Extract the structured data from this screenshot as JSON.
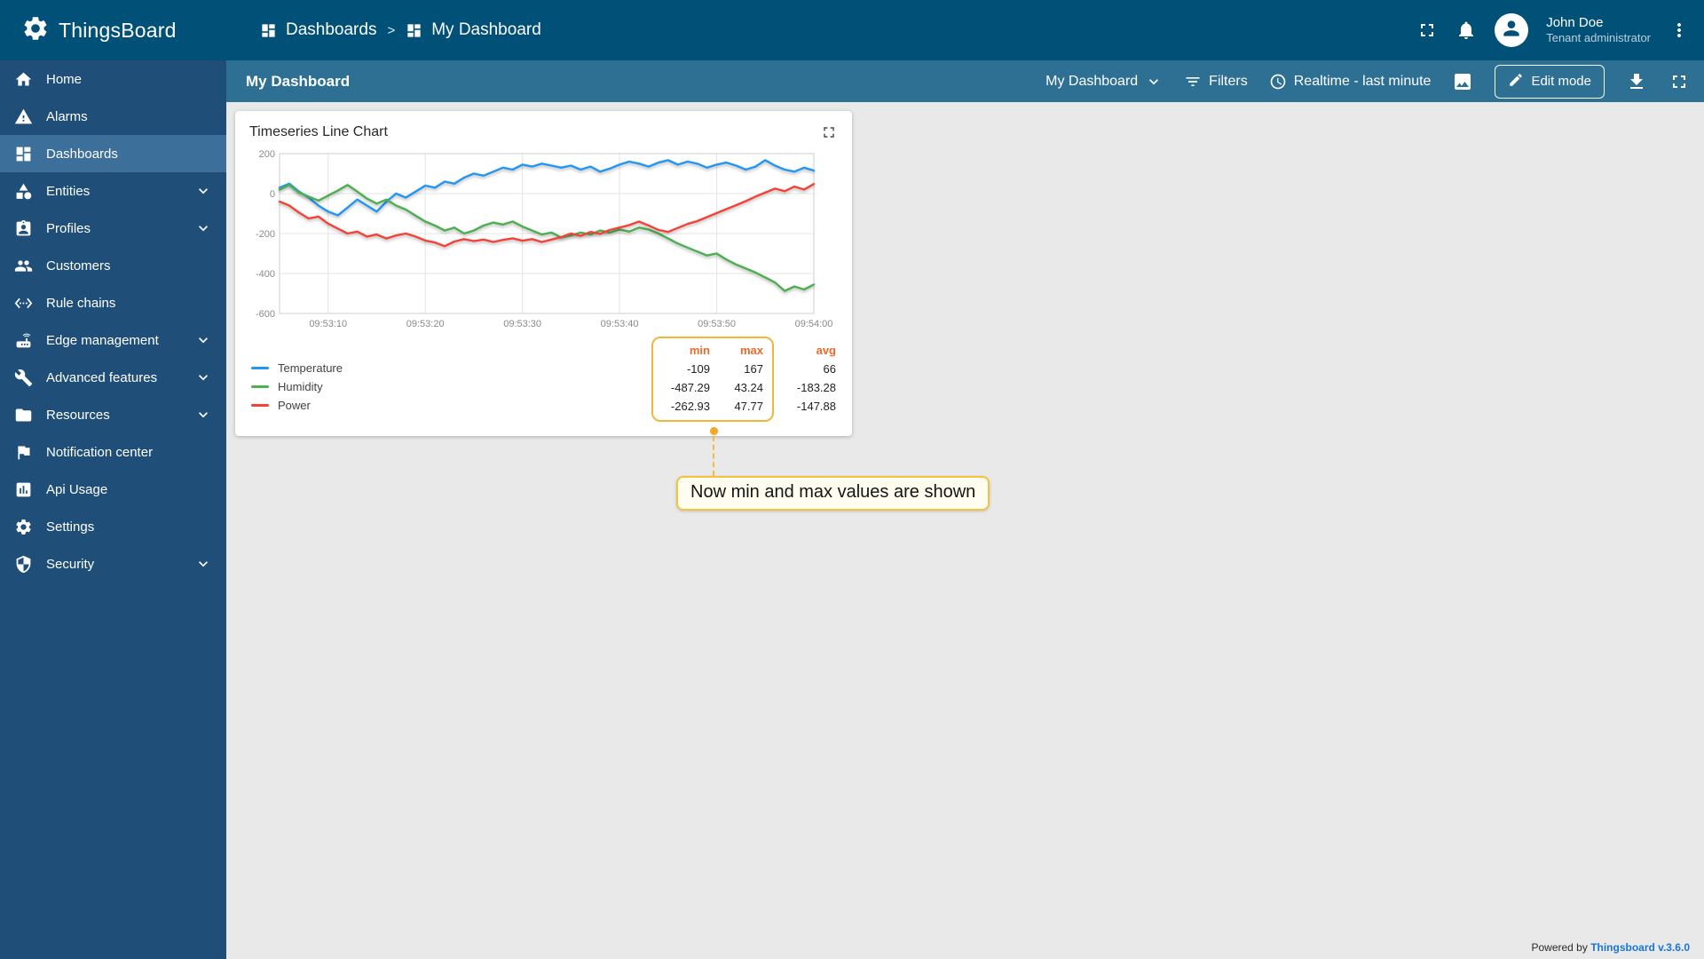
{
  "app": {
    "logo_text": "ThingsBoard",
    "powered_by": "Powered by",
    "powered_link": "Thingsboard v.3.6.0"
  },
  "topbar": {
    "separator": ">",
    "breadcrumb": [
      {
        "label": "Dashboards",
        "icon": "dashboards"
      },
      {
        "label": "My Dashboard",
        "icon": "dashboards"
      }
    ],
    "user": {
      "name": "John Doe",
      "role": "Tenant administrator"
    }
  },
  "sidebar": {
    "items": [
      {
        "label": "Home",
        "icon": "home",
        "expandable": false,
        "active": false
      },
      {
        "label": "Alarms",
        "icon": "alarms",
        "expandable": false,
        "active": false
      },
      {
        "label": "Dashboards",
        "icon": "dashboards",
        "expandable": false,
        "active": true
      },
      {
        "label": "Entities",
        "icon": "entities",
        "expandable": true,
        "active": false
      },
      {
        "label": "Profiles",
        "icon": "profiles",
        "expandable": true,
        "active": false
      },
      {
        "label": "Customers",
        "icon": "customers",
        "expandable": false,
        "active": false
      },
      {
        "label": "Rule chains",
        "icon": "rule-chains",
        "expandable": false,
        "active": false
      },
      {
        "label": "Edge management",
        "icon": "edge",
        "expandable": true,
        "active": false
      },
      {
        "label": "Advanced features",
        "icon": "advanced",
        "expandable": true,
        "active": false
      },
      {
        "label": "Resources",
        "icon": "resources",
        "expandable": true,
        "active": false
      },
      {
        "label": "Notification center",
        "icon": "notification",
        "expandable": false,
        "active": false
      },
      {
        "label": "Api Usage",
        "icon": "api-usage",
        "expandable": false,
        "active": false
      },
      {
        "label": "Settings",
        "icon": "settings",
        "expandable": false,
        "active": false
      },
      {
        "label": "Security",
        "icon": "security",
        "expandable": true,
        "active": false
      }
    ]
  },
  "toolbar": {
    "title": "My Dashboard",
    "dashboard_select": "My Dashboard",
    "filters_label": "Filters",
    "time_label": "Realtime - last minute",
    "edit_label": "Edit mode"
  },
  "widget": {
    "title": "Timeseries Line Chart",
    "legend": {
      "headers": [
        "min",
        "max",
        "avg"
      ],
      "rows": [
        {
          "label": "Temperature",
          "color": "#2196f3",
          "min": "-109",
          "max": "167",
          "avg": "66"
        },
        {
          "label": "Humidity",
          "color": "#4caf50",
          "min": "-487.29",
          "max": "43.24",
          "avg": "-183.28"
        },
        {
          "label": "Power",
          "color": "#f44336",
          "min": "-262.93",
          "max": "47.77",
          "avg": "-147.88"
        }
      ]
    }
  },
  "annotation": {
    "text": "Now min and max values are shown"
  },
  "colors": {
    "highlight_box": "#f2b63c",
    "legend_header": "#f3672a",
    "link": "#1976d2",
    "topbar": "#015078",
    "sidebar": "#1f4f78",
    "toolbar": "#2e7093"
  },
  "chart_data": {
    "type": "line",
    "title": "Timeseries Line Chart",
    "xlabel": "",
    "ylabel": "",
    "grid": true,
    "legend_position": "bottom",
    "xlim": [
      0,
      55
    ],
    "ylim": [
      -600,
      200
    ],
    "y_ticks": [
      200,
      0,
      -200,
      -400,
      -600
    ],
    "x_ticks": [
      "09:53:10",
      "09:53:20",
      "09:53:30",
      "09:53:40",
      "09:53:50",
      "09:54:00"
    ],
    "tick_x": [
      5,
      15,
      25,
      35,
      45,
      55
    ],
    "series": [
      {
        "name": "Temperature",
        "color": "#2196f3",
        "min": -109,
        "max": 167,
        "avg": 66,
        "values": [
          30,
          50,
          10,
          -20,
          -60,
          -90,
          -109,
          -70,
          -30,
          -60,
          -90,
          -40,
          0,
          -20,
          10,
          40,
          30,
          60,
          50,
          80,
          100,
          90,
          110,
          130,
          120,
          145,
          135,
          150,
          140,
          130,
          140,
          120,
          135,
          110,
          125,
          145,
          160,
          150,
          135,
          155,
          167,
          145,
          160,
          150,
          130,
          145,
          155,
          140,
          120,
          135,
          167,
          140,
          120,
          110,
          130,
          115
        ]
      },
      {
        "name": "Humidity",
        "color": "#4caf50",
        "min": -487.29,
        "max": 43.24,
        "avg": -183.28,
        "values": [
          20,
          43,
          5,
          -15,
          -35,
          -10,
          15,
          43,
          10,
          -25,
          -50,
          -30,
          -60,
          -80,
          -110,
          -140,
          -160,
          -185,
          -170,
          -200,
          -185,
          -160,
          -145,
          -155,
          -140,
          -165,
          -185,
          -205,
          -195,
          -220,
          -210,
          -195,
          -205,
          -185,
          -195,
          -180,
          -190,
          -170,
          -180,
          -200,
          -225,
          -250,
          -270,
          -290,
          -310,
          -300,
          -330,
          -355,
          -375,
          -395,
          -420,
          -445,
          -487,
          -465,
          -480,
          -455
        ]
      },
      {
        "name": "Power",
        "color": "#f44336",
        "min": -262.93,
        "max": 47.77,
        "avg": -147.88,
        "values": [
          -40,
          -60,
          -95,
          -125,
          -115,
          -150,
          -175,
          -200,
          -190,
          -215,
          -205,
          -225,
          -210,
          -200,
          -215,
          -235,
          -245,
          -263,
          -240,
          -228,
          -238,
          -230,
          -242,
          -232,
          -224,
          -236,
          -228,
          -242,
          -230,
          -218,
          -200,
          -212,
          -192,
          -202,
          -182,
          -170,
          -158,
          -140,
          -160,
          -182,
          -192,
          -172,
          -152,
          -138,
          -118,
          -98,
          -78,
          -58,
          -38,
          -15,
          5,
          25,
          12,
          35,
          20,
          48
        ]
      }
    ]
  }
}
